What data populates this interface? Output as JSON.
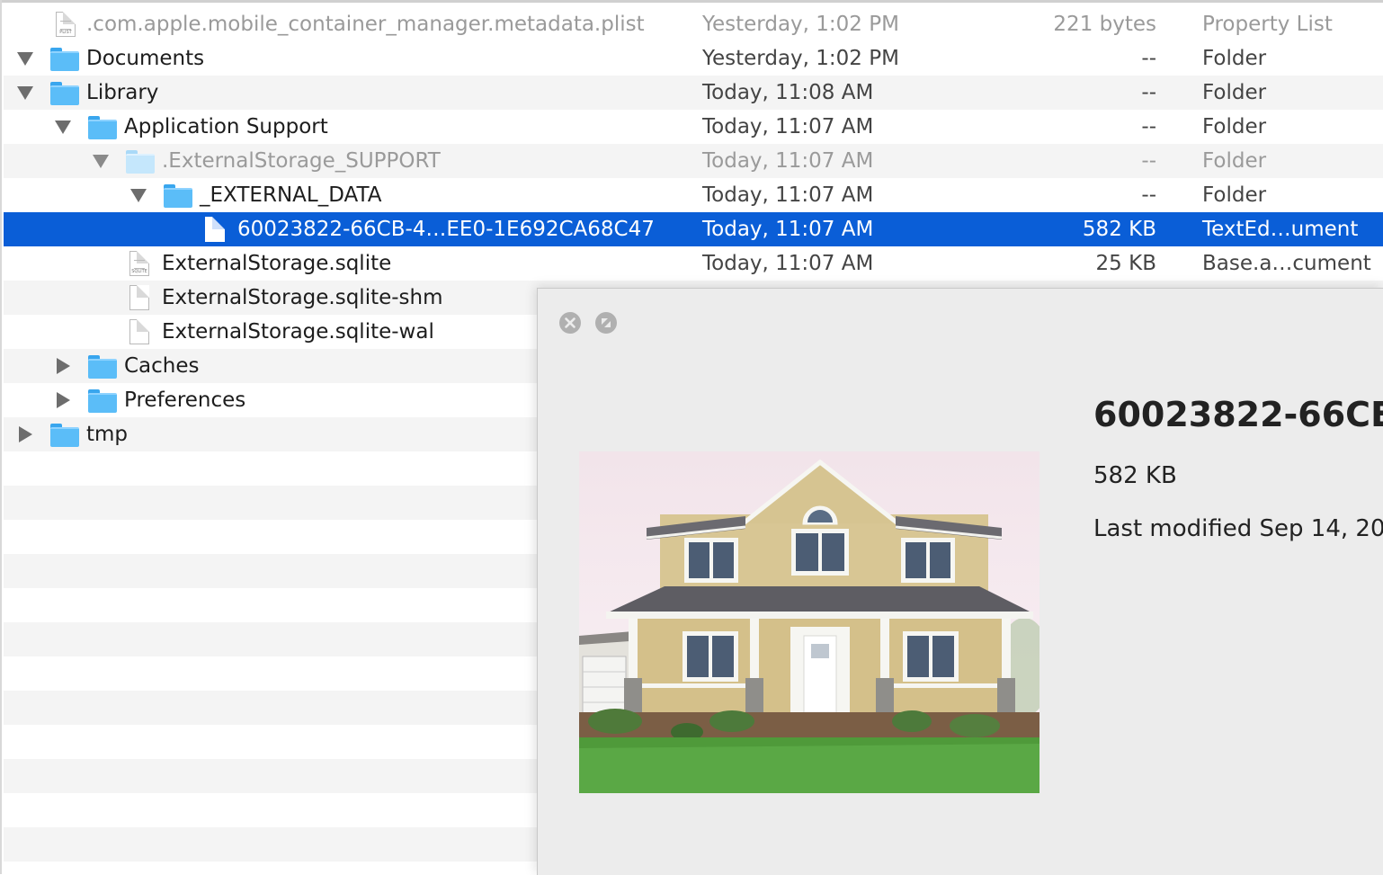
{
  "rows": [
    {
      "name": ".com.apple.mobile_container_manager.metadata.plist",
      "date": "Yesterday, 1:02 PM",
      "size": "221 bytes",
      "kind": "Property List"
    },
    {
      "name": "Documents",
      "date": "Yesterday, 1:02 PM",
      "size": "--",
      "kind": "Folder"
    },
    {
      "name": "Library",
      "date": "Today, 11:08 AM",
      "size": "--",
      "kind": "Folder"
    },
    {
      "name": "Application Support",
      "date": "Today, 11:07 AM",
      "size": "--",
      "kind": "Folder"
    },
    {
      "name": ".ExternalStorage_SUPPORT",
      "date": "Today, 11:07 AM",
      "size": "--",
      "kind": "Folder"
    },
    {
      "name": "_EXTERNAL_DATA",
      "date": "Today, 11:07 AM",
      "size": "--",
      "kind": "Folder"
    },
    {
      "name": "60023822-66CB-4…EE0-1E692CA68C47",
      "date": "Today, 11:07 AM",
      "size": "582 KB",
      "kind": "TextEd…ument"
    },
    {
      "name": "ExternalStorage.sqlite",
      "date": "Today, 11:07 AM",
      "size": "25 KB",
      "kind": "Base.a…cument"
    },
    {
      "name": "ExternalStorage.sqlite-shm",
      "date": "",
      "size": "",
      "kind": ""
    },
    {
      "name": "ExternalStorage.sqlite-wal",
      "date": "",
      "size": "",
      "kind": ""
    },
    {
      "name": "Caches",
      "date": "",
      "size": "",
      "kind": ""
    },
    {
      "name": "Preferences",
      "date": "",
      "size": "",
      "kind": ""
    },
    {
      "name": "tmp",
      "date": "",
      "size": "",
      "kind": ""
    }
  ],
  "icons": {
    "plist": "plist-file-icon",
    "folder": "folder-icon",
    "document": "document-icon",
    "sqlite": "sqlite-file-icon"
  },
  "icon_labels": {
    "plist": "PLIST",
    "sqlite": "SQLITE"
  },
  "quicklook": {
    "title": "60023822-66CE",
    "size": "582 KB",
    "modified": "Last modified Sep 14, 20",
    "preview": "house-photo"
  },
  "colors": {
    "selection": "#0a5ed7",
    "folder": "#5bbdf8",
    "stripe": "#f4f4f4"
  }
}
